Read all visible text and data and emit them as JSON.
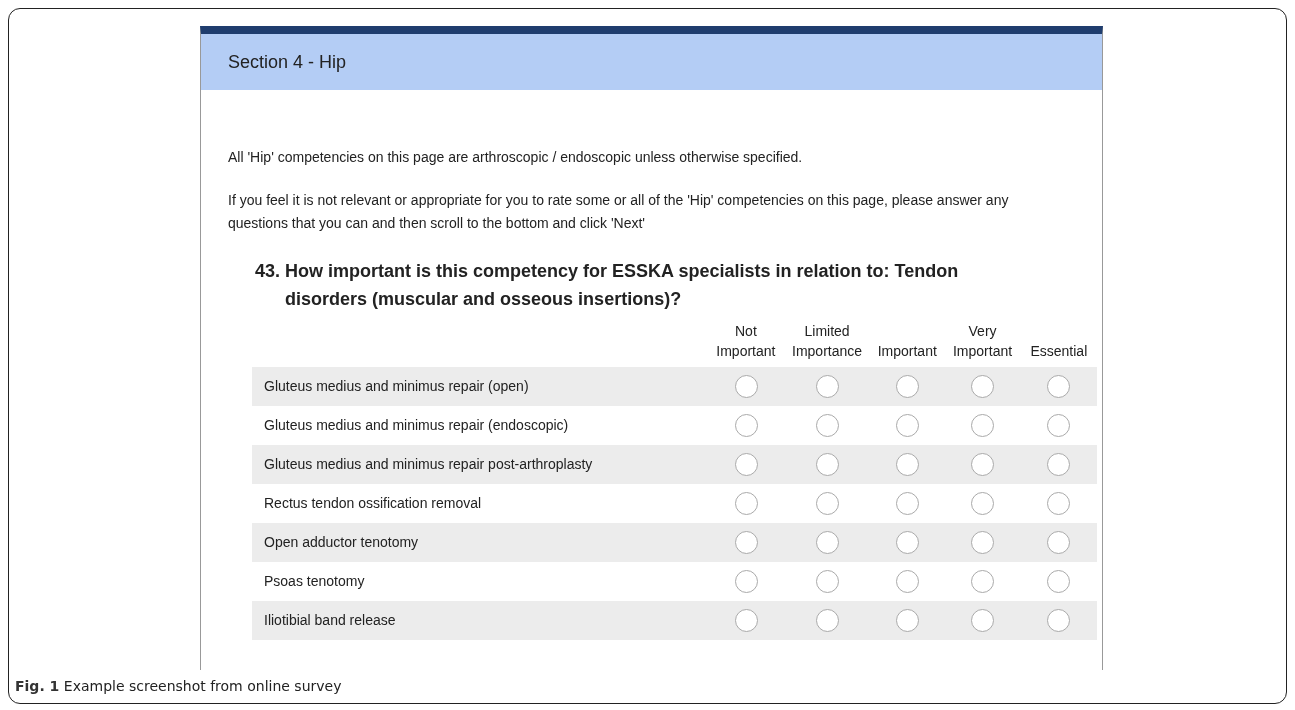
{
  "section_title": "Section 4 - Hip",
  "intro": [
    "All 'Hip' competencies on this page are arthroscopic / endoscopic unless otherwise specified.",
    "If you feel it is not relevant or appropriate for you to rate some or all of the 'Hip' competencies on this page, please answer any questions that you can and then scroll to the bottom and click 'Next'"
  ],
  "question": {
    "number": "43.",
    "text": "How important is this competency for ESSKA specialists in relation to: Tendon disorders (muscular and osseous insertions)?"
  },
  "columns": [
    [
      "Not",
      "Important"
    ],
    [
      "Limited",
      "Importance"
    ],
    [
      "",
      "Important"
    ],
    [
      "Very",
      "Important"
    ],
    [
      "",
      "Essential"
    ]
  ],
  "rows": [
    {
      "label": "Gluteus medius and minimus repair (open)",
      "options": [
        {
          "selected": false
        },
        {
          "selected": false
        },
        {
          "selected": false
        },
        {
          "selected": false
        },
        {
          "selected": false
        }
      ]
    },
    {
      "label": "Gluteus medius and minimus repair (endoscopic)",
      "options": [
        {
          "selected": false
        },
        {
          "selected": false
        },
        {
          "selected": false
        },
        {
          "selected": false
        },
        {
          "selected": false
        }
      ]
    },
    {
      "label": "Gluteus medius and minimus repair post-arthroplasty",
      "options": [
        {
          "selected": false
        },
        {
          "selected": false
        },
        {
          "selected": false
        },
        {
          "selected": false
        },
        {
          "selected": false
        }
      ]
    },
    {
      "label": "Rectus tendon ossification removal",
      "options": [
        {
          "selected": false
        },
        {
          "selected": false
        },
        {
          "selected": false
        },
        {
          "selected": false
        },
        {
          "selected": false
        }
      ]
    },
    {
      "label": "Open adductor tenotomy",
      "options": [
        {
          "selected": false
        },
        {
          "selected": false
        },
        {
          "selected": false
        },
        {
          "selected": false
        },
        {
          "selected": false
        }
      ]
    },
    {
      "label": "Psoas tenotomy",
      "options": [
        {
          "selected": false
        },
        {
          "selected": false
        },
        {
          "selected": false
        },
        {
          "selected": false
        },
        {
          "selected": false
        }
      ]
    },
    {
      "label": "Iliotibial band release",
      "options": [
        {
          "selected": false
        },
        {
          "selected": false
        },
        {
          "selected": false
        },
        {
          "selected": false
        },
        {
          "selected": false
        }
      ]
    }
  ],
  "caption": {
    "label": "Fig. 1",
    "text": "Example screenshot from online survey"
  }
}
